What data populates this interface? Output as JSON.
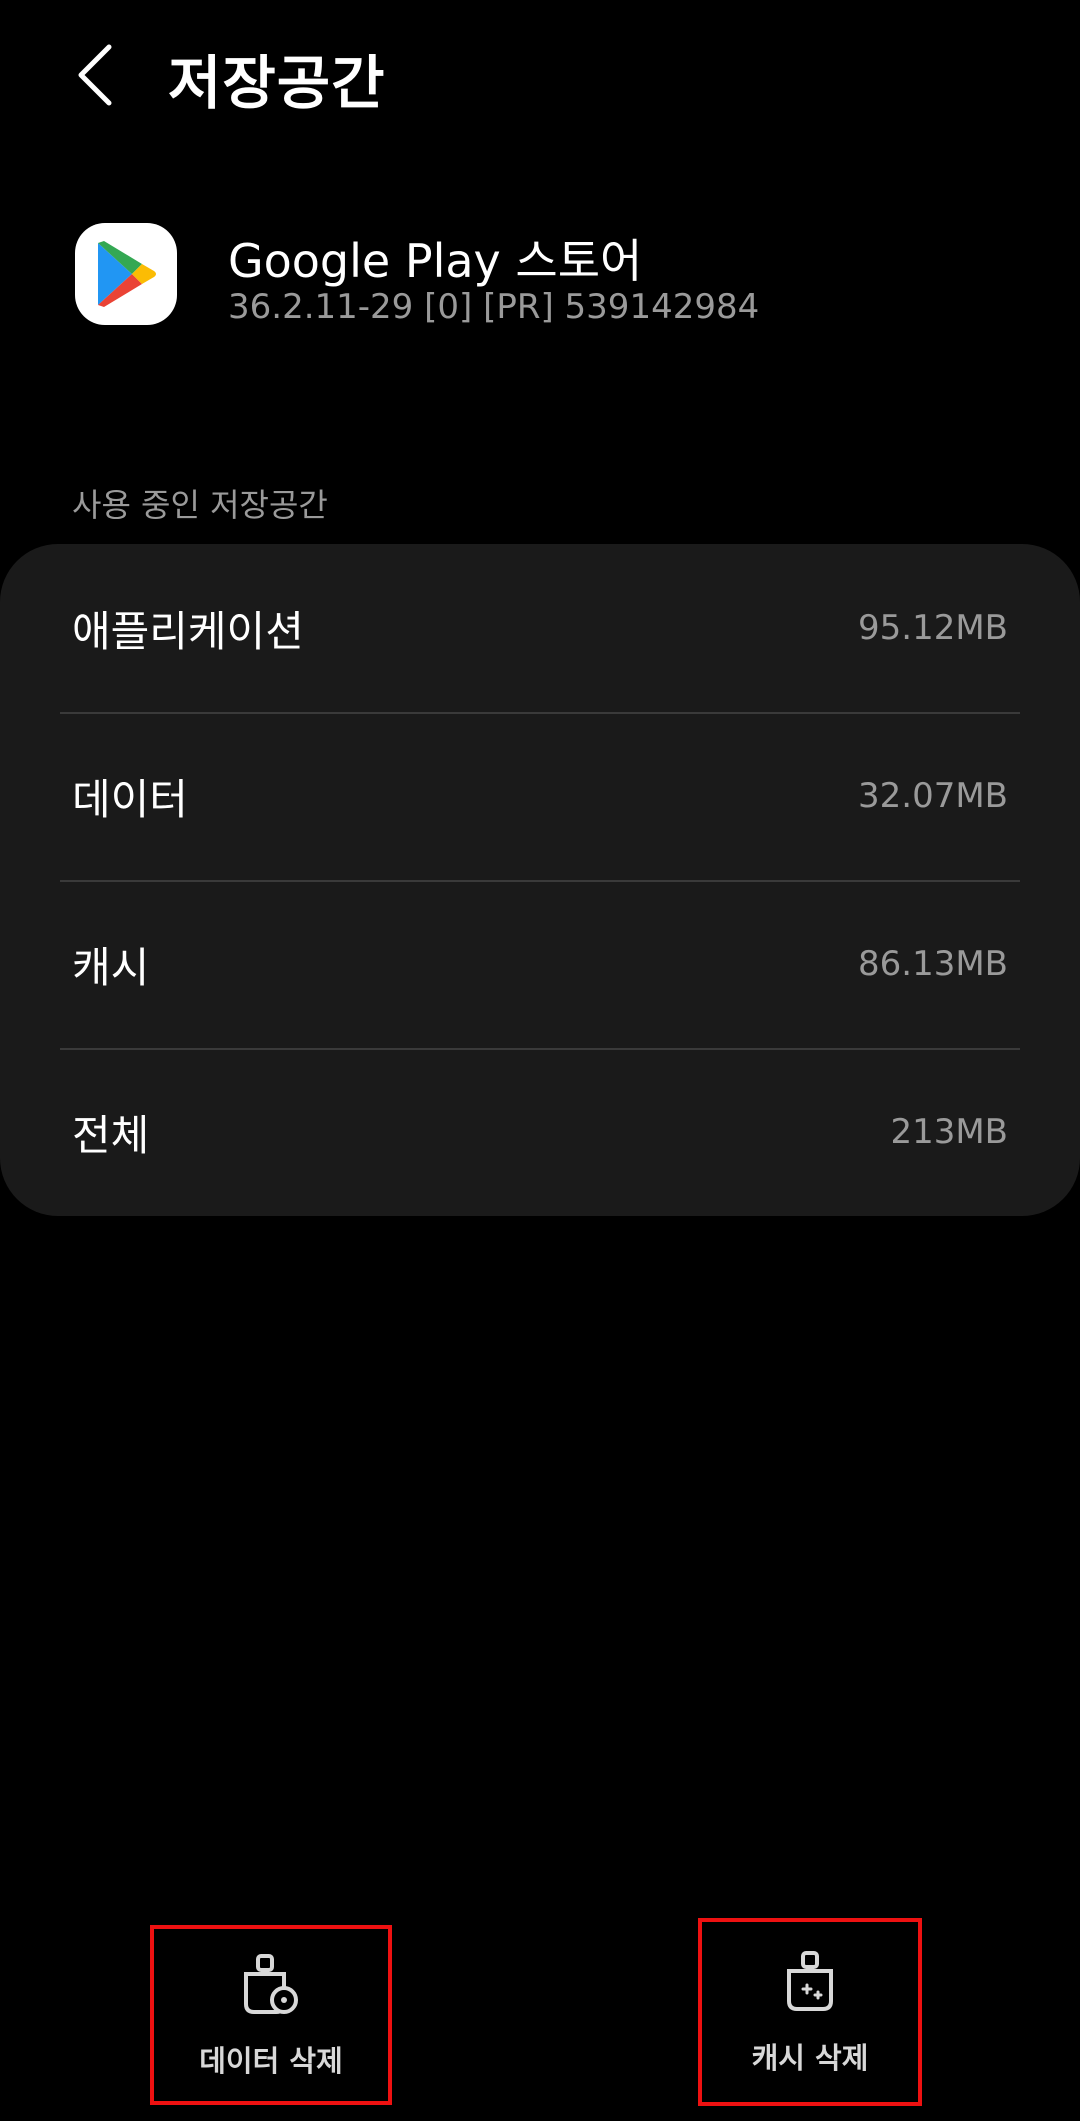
{
  "header": {
    "title": "저장공간"
  },
  "app": {
    "name": "Google Play 스토어",
    "version": "36.2.11-29 [0] [PR] 539142984",
    "icon": "google-play-icon"
  },
  "storage": {
    "section_label": "사용 중인 저장공간",
    "rows": [
      {
        "label": "애플리케이션",
        "value": "95.12MB"
      },
      {
        "label": "데이터",
        "value": "32.07MB"
      },
      {
        "label": "캐시",
        "value": "86.13MB"
      },
      {
        "label": "전체",
        "value": "213MB"
      }
    ]
  },
  "actions": {
    "clear_data": {
      "label": "데이터 삭제",
      "icon": "brush-clear-data-icon"
    },
    "clear_cache": {
      "label": "캐시 삭제",
      "icon": "brush-clear-cache-icon"
    }
  },
  "colors": {
    "background": "#000000",
    "card": "#1a1a1a",
    "secondary_text": "#9a9a9a",
    "highlight_box": "#ee1111"
  }
}
